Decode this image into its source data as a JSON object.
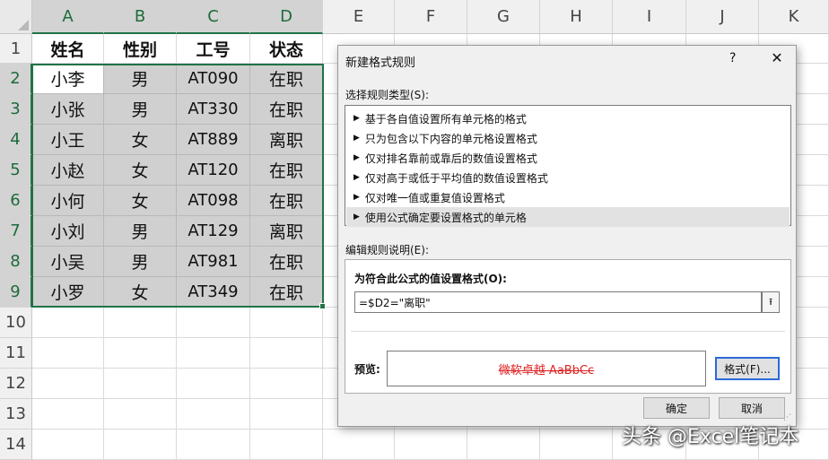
{
  "spreadsheet": {
    "columns": [
      "A",
      "B",
      "C",
      "D",
      "E",
      "F",
      "G",
      "H",
      "I",
      "J",
      "K"
    ],
    "rows": [
      "1",
      "2",
      "3",
      "4",
      "5",
      "6",
      "7",
      "8",
      "9",
      "10",
      "11",
      "12",
      "13",
      "14"
    ],
    "header_row": [
      "姓名",
      "性别",
      "工号",
      "状态"
    ],
    "data_rows": [
      [
        "小李",
        "男",
        "AT090",
        "在职"
      ],
      [
        "小张",
        "男",
        "AT330",
        "在职"
      ],
      [
        "小王",
        "女",
        "AT889",
        "离职"
      ],
      [
        "小赵",
        "女",
        "AT120",
        "在职"
      ],
      [
        "小何",
        "女",
        "AT098",
        "在职"
      ],
      [
        "小刘",
        "男",
        "AT129",
        "离职"
      ],
      [
        "小吴",
        "男",
        "AT981",
        "在职"
      ],
      [
        "小罗",
        "女",
        "AT349",
        "在职"
      ]
    ],
    "selection_color": "#217346"
  },
  "dialog": {
    "title": "新建格式规则",
    "help": "?",
    "close": "✕",
    "rule_type_label": "选择规则类型(S):",
    "rule_types": [
      "基于各自值设置所有单元格的格式",
      "只为包含以下内容的单元格设置格式",
      "仅对排名靠前或靠后的数值设置格式",
      "仅对高于或低于平均值的数值设置格式",
      "仅对唯一值或重复值设置格式",
      "使用公式确定要设置格式的单元格"
    ],
    "selected_rule_index": 5,
    "edit_label": "编辑规则说明(E):",
    "formula_label": "为符合此公式的值设置格式(O):",
    "formula_value": "=$D2=\"离职\"",
    "preview_label": "预览:",
    "preview_text": "微软卓越  AaBbCc",
    "preview_color": "#e02020",
    "format_button": "格式(F)...",
    "ok_button": "确定",
    "cancel_button": "取消"
  },
  "watermark": "头条 @Excel笔记本"
}
